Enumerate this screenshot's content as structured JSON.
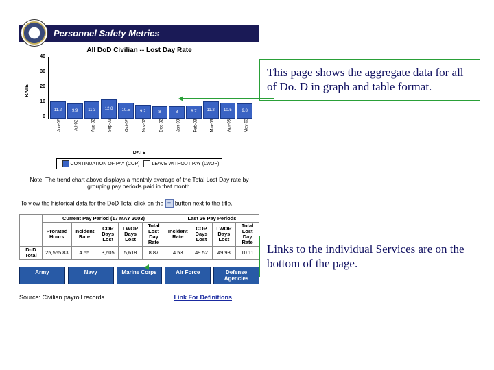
{
  "header": {
    "title": "Personnel Safety Metrics"
  },
  "chart_data": {
    "type": "bar",
    "title": "All DoD Civilian -- Lost Day Rate",
    "ylabel": "RATE",
    "xlabel": "DATE",
    "ylim": [
      0,
      40
    ],
    "yticks": [
      0,
      10,
      20,
      30,
      40
    ],
    "categories": [
      "Jun-02",
      "Jul-02",
      "Aug-02",
      "Sep-02",
      "Oct-02",
      "Nov-02",
      "Dec-02",
      "Jan-03",
      "Feb-03",
      "Mar-03",
      "Apr-03",
      "May-03"
    ],
    "values": [
      11.2,
      9.9,
      11.3,
      12.8,
      10.5,
      9.2,
      8.0,
      8.0,
      8.7,
      11.2,
      10.5,
      9.8
    ],
    "legend": [
      "CONTINUATION OF PAY (COP)",
      "LEAVE WITHOUT PAY (LWOP)"
    ]
  },
  "note": "Note: The trend chart above displays a monthly average of the Total Lost Day rate by grouping pay periods paid in that month.",
  "instruction": {
    "pre": "To view the historical data for the DoD Total click on the ",
    "post": " button next to the title."
  },
  "table": {
    "span_left": "Current Pay Period (17 MAY 2003)",
    "span_right": "Last 26 Pay Periods",
    "headers_left": [
      "",
      "Prorated Hours",
      "Incident Rate",
      "COP Days Lost",
      "LWOP Days Lost",
      "Total Lost Day Rate"
    ],
    "headers_right": [
      "Incident Rate",
      "COP Days Lost",
      "LWOP Days Lost",
      "Total Lost Day Rate"
    ],
    "row_label": "DoD Total",
    "row_vals": [
      "25,555.83",
      "4.55",
      "3,605",
      "5,618",
      "8.87",
      "4.53",
      "49.52",
      "49.93",
      "10.11"
    ]
  },
  "services": [
    "Army",
    "Navy",
    "Marine Corps",
    "Air Force",
    "Defense Agencies"
  ],
  "source": {
    "label": "Source: Civilian payroll records",
    "deflink": "Link For Definitions"
  },
  "callouts": {
    "top": "This page shows the aggregate data for all of Do. D in graph and table format.",
    "bottom": "Links to the individual Services are on the bottom of the page."
  }
}
